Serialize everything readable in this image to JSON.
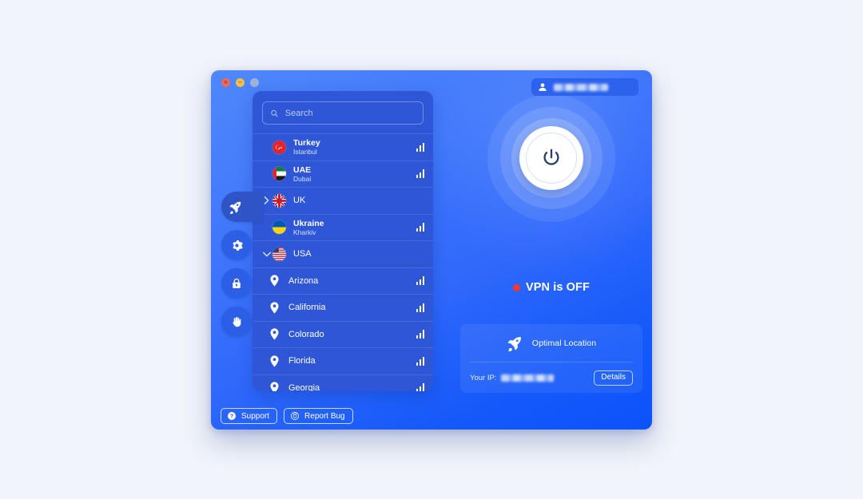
{
  "window": {
    "traffic_lights": [
      {
        "name": "close",
        "glyph": "×",
        "color": "#ec6a5f"
      },
      {
        "name": "minimize",
        "glyph": "−",
        "color": "#f4bd4f"
      },
      {
        "name": "maximize",
        "glyph": "",
        "color": "#9cb3d9"
      }
    ]
  },
  "account": {
    "icon": "person-icon",
    "username_redacted": true
  },
  "rail": {
    "items": [
      {
        "name": "rocket-icon",
        "label": "Locations",
        "active": true
      },
      {
        "name": "gear-icon",
        "label": "Settings",
        "active": false
      },
      {
        "name": "lock-icon",
        "label": "Security",
        "active": false
      },
      {
        "name": "hand-icon",
        "label": "Privacy",
        "active": false
      }
    ]
  },
  "search": {
    "placeholder": "Search",
    "value": "",
    "icon": "search-icon"
  },
  "locations": [
    {
      "name": "Turkey",
      "city": "Istanbul",
      "flag": "tr",
      "type": "country",
      "expandable": false,
      "signal": 3
    },
    {
      "name": "UAE",
      "city": "Dubai",
      "flag": "ae",
      "type": "country",
      "expandable": false,
      "signal": 3
    },
    {
      "name": "UK",
      "city": "",
      "flag": "gb",
      "type": "country",
      "expandable": true,
      "expanded": false,
      "signal": 0
    },
    {
      "name": "Ukraine",
      "city": "Kharkiv",
      "flag": "ua",
      "type": "country",
      "expandable": false,
      "signal": 3
    },
    {
      "name": "USA",
      "city": "",
      "flag": "us",
      "type": "country",
      "expandable": true,
      "expanded": true,
      "signal": 0
    },
    {
      "name": "Arizona",
      "city": "",
      "flag": "",
      "type": "region",
      "expandable": false,
      "signal": 3
    },
    {
      "name": "California",
      "city": "",
      "flag": "",
      "type": "region",
      "expandable": false,
      "signal": 3
    },
    {
      "name": "Colorado",
      "city": "",
      "flag": "",
      "type": "region",
      "expandable": false,
      "signal": 3
    },
    {
      "name": "Florida",
      "city": "",
      "flag": "",
      "type": "region",
      "expandable": false,
      "signal": 3
    },
    {
      "name": "Georgia",
      "city": "",
      "flag": "",
      "type": "region",
      "expandable": false,
      "signal": 3
    }
  ],
  "connection": {
    "power_icon": "power-icon",
    "status_text": "VPN is OFF",
    "status_color": "#f4382a",
    "connected": false
  },
  "optimal": {
    "icon": "rocket-icon",
    "label": "Optimal Location",
    "ip_label": "Your IP:",
    "ip_redacted": true,
    "details_label": "Details"
  },
  "footer": {
    "support_label": "Support",
    "support_icon": "question-circle-icon",
    "report_label": "Report Bug",
    "report_icon": "bug-target-icon"
  }
}
